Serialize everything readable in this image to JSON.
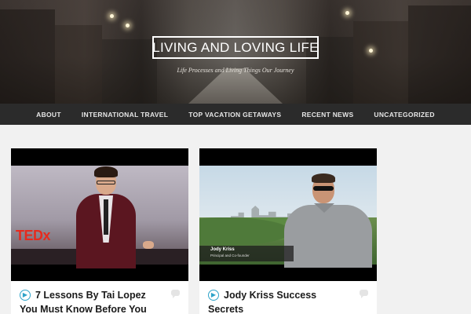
{
  "site": {
    "title": "LIVING AND LOVING LIFE",
    "tagline": "Life Processes and Living Things Our Journey"
  },
  "nav": {
    "items": [
      {
        "label": "ABOUT"
      },
      {
        "label": "INTERNATIONAL TRAVEL"
      },
      {
        "label": "TOP VACATION GETAWAYS"
      },
      {
        "label": "RECENT NEWS"
      },
      {
        "label": "UNCATEGORIZED"
      }
    ]
  },
  "posts": [
    {
      "title_line1": "7 Lessons By Tai Lopez",
      "title_line2": "You Must Know Before You",
      "thumb_logo": "TEDx",
      "post_icon": "video-format-icon",
      "comments_icon": "comment-bubble-icon"
    },
    {
      "title_line1": "Jody Kriss Success",
      "title_line2": "Secrets",
      "lower_third_name": "Jody Kriss",
      "lower_third_role": "Principal and Co-founder",
      "post_icon": "video-format-icon",
      "comments_icon": "comment-bubble-icon"
    }
  ],
  "colors": {
    "nav_bg": "#2b2b2b",
    "accent": "#2ea3c9",
    "page_bg": "#f1f1f1",
    "tedx_red": "#e62b1e"
  }
}
